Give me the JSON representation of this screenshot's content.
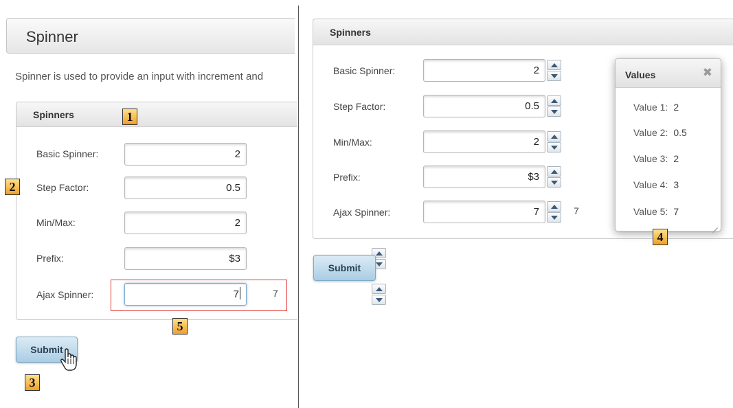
{
  "left_panel": {
    "header_title": "Spinner",
    "intro_text": "Spinner is used to provide an input with increment and",
    "legend": "Spinners",
    "rows": [
      {
        "label": "Basic Spinner:",
        "value": "2"
      },
      {
        "label": "Step Factor:",
        "value": "0.5"
      },
      {
        "label": "Min/Max:",
        "value": "2"
      },
      {
        "label": "Prefix:",
        "value": "$3"
      },
      {
        "label": "Ajax Spinner:",
        "value": "7"
      }
    ],
    "ajax_output": "7",
    "submit_label": "Submit"
  },
  "right_panel": {
    "legend": "Spinners",
    "rows": [
      {
        "label": "Basic Spinner:",
        "value": "2"
      },
      {
        "label": "Step Factor:",
        "value": "0.5"
      },
      {
        "label": "Min/Max:",
        "value": "2"
      },
      {
        "label": "Prefix:",
        "value": "$3"
      },
      {
        "label": "Ajax Spinner:",
        "value": "7"
      }
    ],
    "ajax_output": "7",
    "submit_label": "Submit"
  },
  "dialog": {
    "title": "Values",
    "close_icon": "close-icon",
    "values": [
      {
        "label": "Value 1:",
        "value": "2"
      },
      {
        "label": "Value 2:",
        "value": "0.5"
      },
      {
        "label": "Value 3:",
        "value": "2"
      },
      {
        "label": "Value 4:",
        "value": "3"
      },
      {
        "label": "Value 5:",
        "value": "7"
      }
    ]
  },
  "annotations": [
    "1",
    "2",
    "3",
    "4",
    "5"
  ],
  "colors": {
    "annotation_fill": "#f0a02a",
    "highlight_border": "#e03030",
    "button_blue": "#a9cde4",
    "spin_arrow": "#3a5a78"
  }
}
